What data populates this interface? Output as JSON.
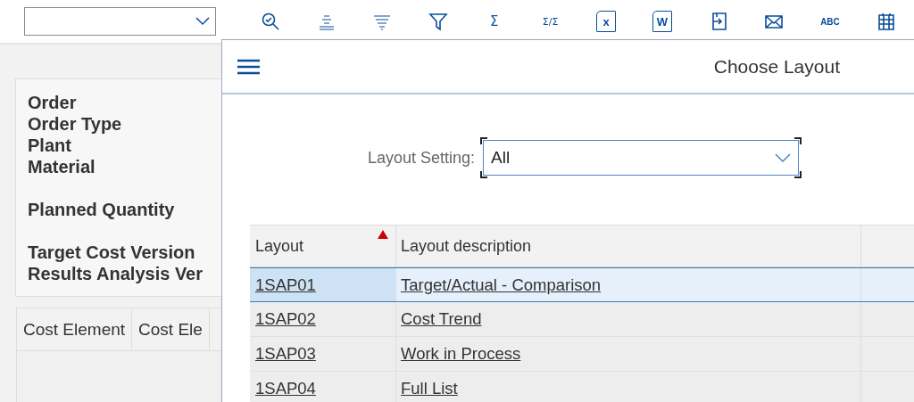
{
  "toolbar": {
    "tools": [
      {
        "kind": "zoom"
      },
      {
        "kind": "align-center"
      },
      {
        "kind": "sort-lines"
      },
      {
        "kind": "filter"
      },
      {
        "kind": "sum",
        "glyph": "Σ"
      },
      {
        "kind": "subtotal",
        "glyph": "Σ/Σ"
      },
      {
        "kind": "excel",
        "glyph": "x"
      },
      {
        "kind": "word",
        "glyph": "W"
      },
      {
        "kind": "export"
      },
      {
        "kind": "mail"
      },
      {
        "kind": "abc",
        "glyph": "ABC"
      },
      {
        "kind": "grid"
      }
    ]
  },
  "header_panel": {
    "groups": [
      [
        "Order",
        "Order Type",
        "Plant",
        "Material"
      ],
      [
        "Planned Quantity"
      ],
      [
        "Target Cost Version",
        "Results Analysis Ver"
      ]
    ]
  },
  "cost_table": {
    "columns": [
      "Cost Element",
      "Cost Ele"
    ]
  },
  "dialog": {
    "title": "Choose Layout",
    "layout_setting": {
      "label": "Layout Setting:",
      "value": "All"
    },
    "table": {
      "columns": [
        {
          "label": "Layout",
          "sorted": true
        },
        {
          "label": "Layout description",
          "sorted": false
        }
      ],
      "rows": [
        {
          "layout": "1SAP01",
          "description": "Target/Actual - Comparison",
          "selected": true
        },
        {
          "layout": "1SAP02",
          "description": "Cost Trend",
          "selected": false
        },
        {
          "layout": "1SAP03",
          "description": "Work in Process",
          "selected": false
        },
        {
          "layout": "1SAP04",
          "description": "Full List",
          "selected": false
        }
      ]
    }
  }
}
